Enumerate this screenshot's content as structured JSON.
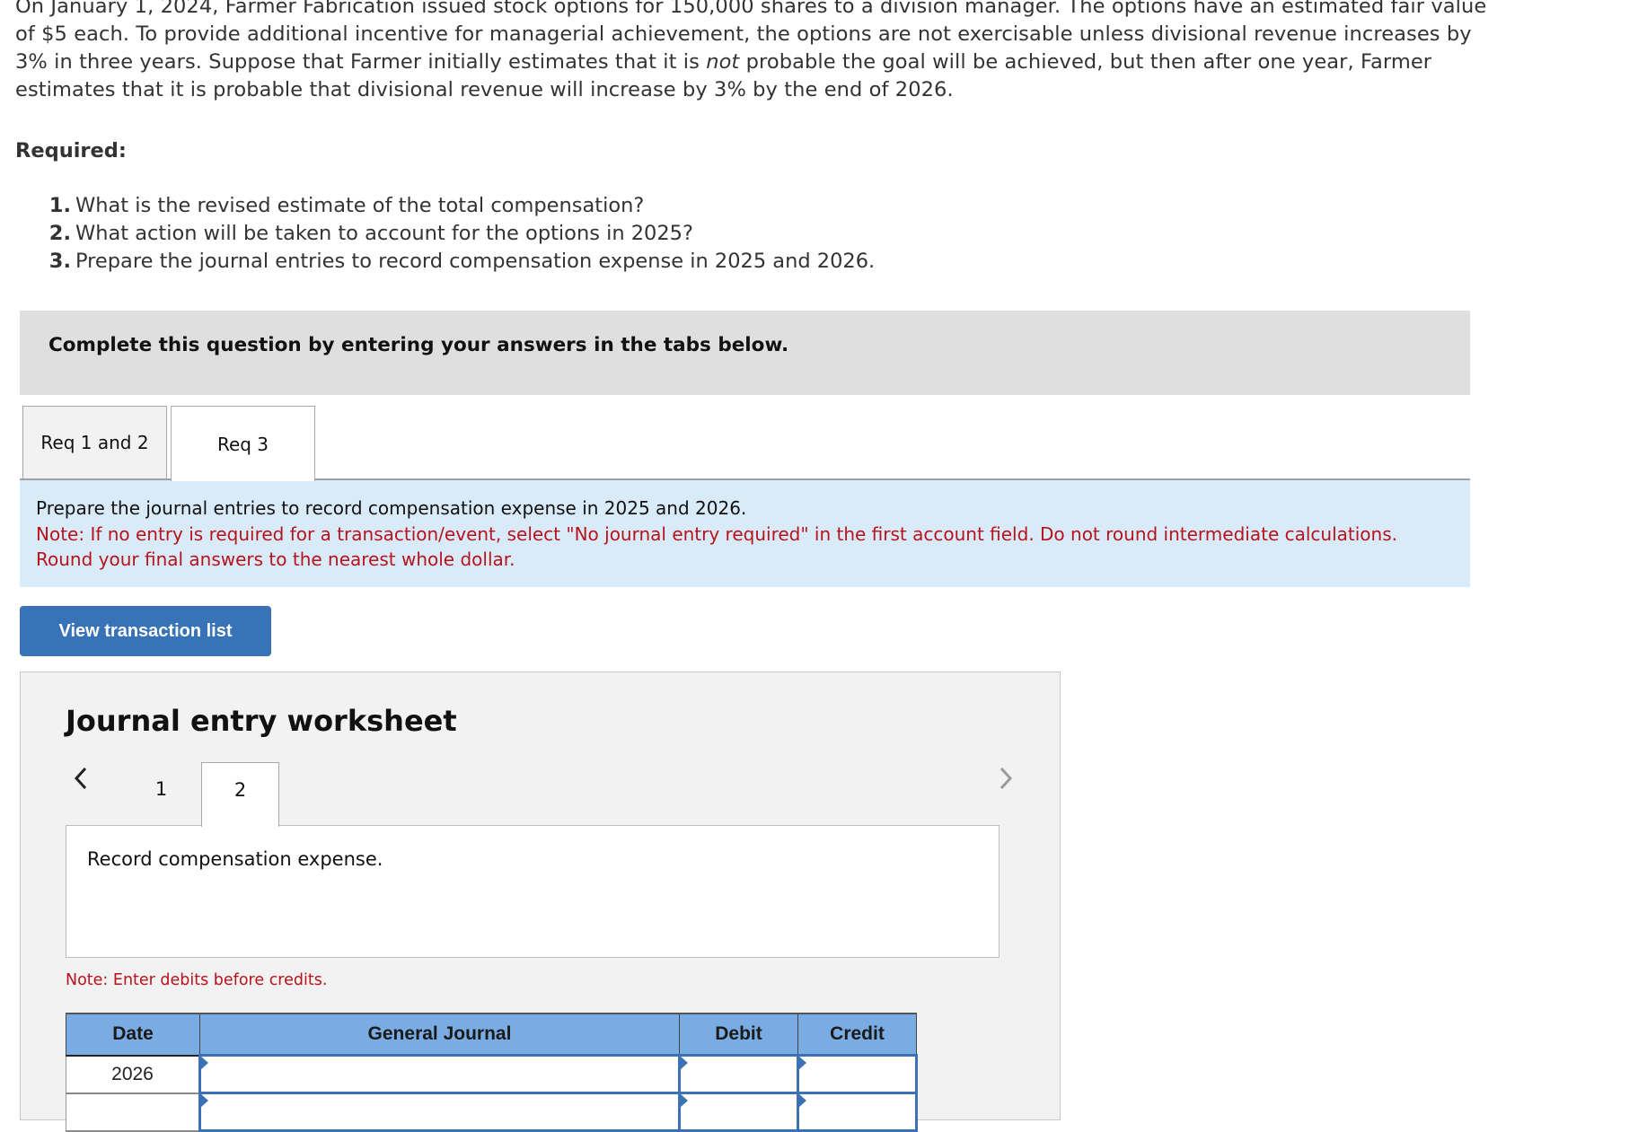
{
  "problem": {
    "intro_before_italic": "On January 1, 2024, Farmer Fabrication issued stock options for 150,000 shares to a division manager. The options have an estimated fair value of $5 each. To provide additional incentive for managerial achievement, the options are not exercisable unless divisional revenue increases by 3% in three years. Suppose that Farmer initially estimates that it is ",
    "intro_italic": "not",
    "intro_after_italic": " probable the goal will be achieved, but then after one year, Farmer estimates that it is probable that divisional revenue will increase by 3% by the end of 2026.",
    "required_label": "Required:",
    "requirements": [
      {
        "num": "1.",
        "text": "What is the revised estimate of the total compensation?"
      },
      {
        "num": "2.",
        "text": "What action will be taken to account for the options in 2025?"
      },
      {
        "num": "3.",
        "text": "Prepare the journal entries to record compensation expense in 2025 and 2026."
      }
    ]
  },
  "banner": {
    "text": "Complete this question by entering your answers in the tabs below."
  },
  "tabs": [
    {
      "label": "Req 1 and 2",
      "active": false
    },
    {
      "label": "Req 3",
      "active": true
    }
  ],
  "instructions": {
    "main": "Prepare the journal entries to record compensation expense in 2025 and 2026.",
    "note": "Note: If no entry is required for a transaction/event, select \"No journal entry required\" in the first account field. Do not round intermediate calculations. Round your final answers to the nearest whole dollar."
  },
  "view_transaction_button": "View transaction list",
  "worksheet": {
    "title": "Journal entry worksheet",
    "prev_icon": "chevron-left-icon",
    "next_icon": "chevron-right-icon",
    "pages": [
      "1",
      "2"
    ],
    "active_page": "2",
    "description": "Record compensation expense.",
    "debit_note": "Note: Enter debits before credits.",
    "table": {
      "headers": [
        "Date",
        "General Journal",
        "Debit",
        "Credit"
      ],
      "rows": [
        {
          "date": "2026",
          "account": "",
          "debit": "",
          "credit": ""
        },
        {
          "date": "",
          "account": "",
          "debit": "",
          "credit": ""
        }
      ]
    }
  },
  "colors": {
    "banner_gray": "#dfdfdf",
    "instruction_blue": "#d9ebf9",
    "note_red": "#b8121b",
    "button_blue": "#3873b7",
    "table_header_blue": "#78ace3",
    "input_border_blue": "#3c72b4"
  }
}
